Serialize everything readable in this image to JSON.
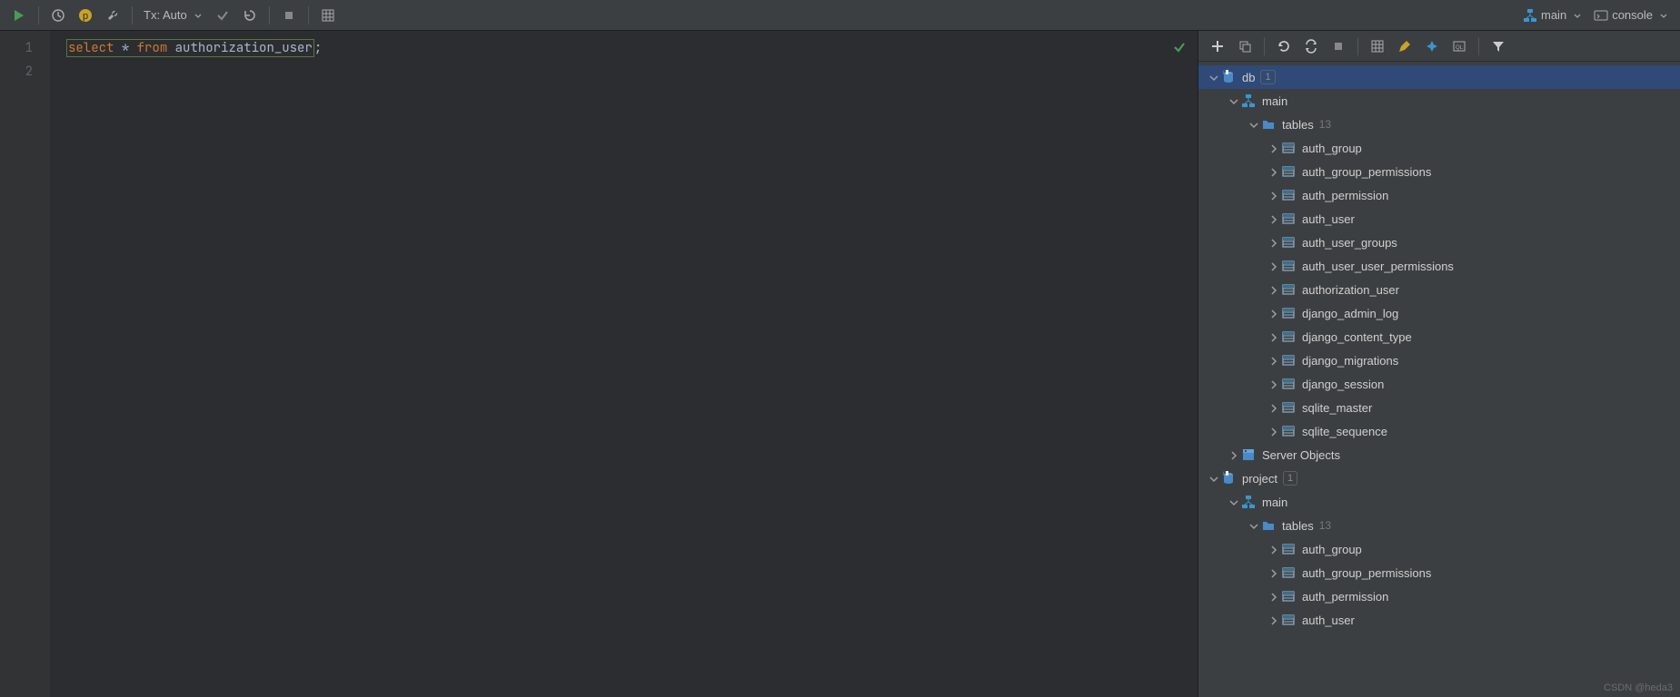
{
  "toolbar": {
    "run": "Run",
    "history": "History",
    "pending": "p",
    "settings": "Settings",
    "txLabel": "Tx: Auto",
    "commit": "Commit",
    "rollback": "Rollback",
    "stop": "Stop",
    "plan": "Explain Plan",
    "schemaDropdown": "main",
    "consoleDropdown": "console"
  },
  "editor": {
    "lines": [
      "1",
      "2"
    ],
    "sql": {
      "kw1": "select",
      "star": "*",
      "kw2": "from",
      "table": "authorization_user",
      "semi": ";"
    }
  },
  "dbToolbar": {
    "add": "Add",
    "duplicate": "Duplicate",
    "refresh": "Refresh",
    "stopRefresh": "Refresh Loop",
    "stop2": "Stop",
    "table": "Table",
    "edit": "Edit",
    "pin": "Pin",
    "ddl": "DDL",
    "filter": "Filter"
  },
  "tree": [
    {
      "depth": 0,
      "expand": "down",
      "icon": "db",
      "label": "db",
      "badge": "1",
      "selected": true
    },
    {
      "depth": 1,
      "expand": "down",
      "icon": "schema",
      "label": "main"
    },
    {
      "depth": 2,
      "expand": "down",
      "icon": "folder",
      "label": "tables",
      "dim": "13"
    },
    {
      "depth": 3,
      "expand": "right",
      "icon": "table",
      "label": "auth_group"
    },
    {
      "depth": 3,
      "expand": "right",
      "icon": "table",
      "label": "auth_group_permissions"
    },
    {
      "depth": 3,
      "expand": "right",
      "icon": "table",
      "label": "auth_permission"
    },
    {
      "depth": 3,
      "expand": "right",
      "icon": "table",
      "label": "auth_user"
    },
    {
      "depth": 3,
      "expand": "right",
      "icon": "table",
      "label": "auth_user_groups"
    },
    {
      "depth": 3,
      "expand": "right",
      "icon": "table",
      "label": "auth_user_user_permissions"
    },
    {
      "depth": 3,
      "expand": "right",
      "icon": "table",
      "label": "authorization_user"
    },
    {
      "depth": 3,
      "expand": "right",
      "icon": "table",
      "label": "django_admin_log"
    },
    {
      "depth": 3,
      "expand": "right",
      "icon": "table",
      "label": "django_content_type"
    },
    {
      "depth": 3,
      "expand": "right",
      "icon": "table",
      "label": "django_migrations"
    },
    {
      "depth": 3,
      "expand": "right",
      "icon": "table",
      "label": "django_session"
    },
    {
      "depth": 3,
      "expand": "right",
      "icon": "table",
      "label": "sqlite_master"
    },
    {
      "depth": 3,
      "expand": "right",
      "icon": "table",
      "label": "sqlite_sequence"
    },
    {
      "depth": 1,
      "expand": "right",
      "icon": "server",
      "label": "Server Objects"
    },
    {
      "depth": 0,
      "expand": "down",
      "icon": "db",
      "label": "project",
      "badge": "1"
    },
    {
      "depth": 1,
      "expand": "down",
      "icon": "schema",
      "label": "main"
    },
    {
      "depth": 2,
      "expand": "down",
      "icon": "folder",
      "label": "tables",
      "dim": "13"
    },
    {
      "depth": 3,
      "expand": "right",
      "icon": "table",
      "label": "auth_group"
    },
    {
      "depth": 3,
      "expand": "right",
      "icon": "table",
      "label": "auth_group_permissions"
    },
    {
      "depth": 3,
      "expand": "right",
      "icon": "table",
      "label": "auth_permission"
    },
    {
      "depth": 3,
      "expand": "right",
      "icon": "table",
      "label": "auth_user"
    }
  ],
  "watermark": "CSDN @heda3"
}
